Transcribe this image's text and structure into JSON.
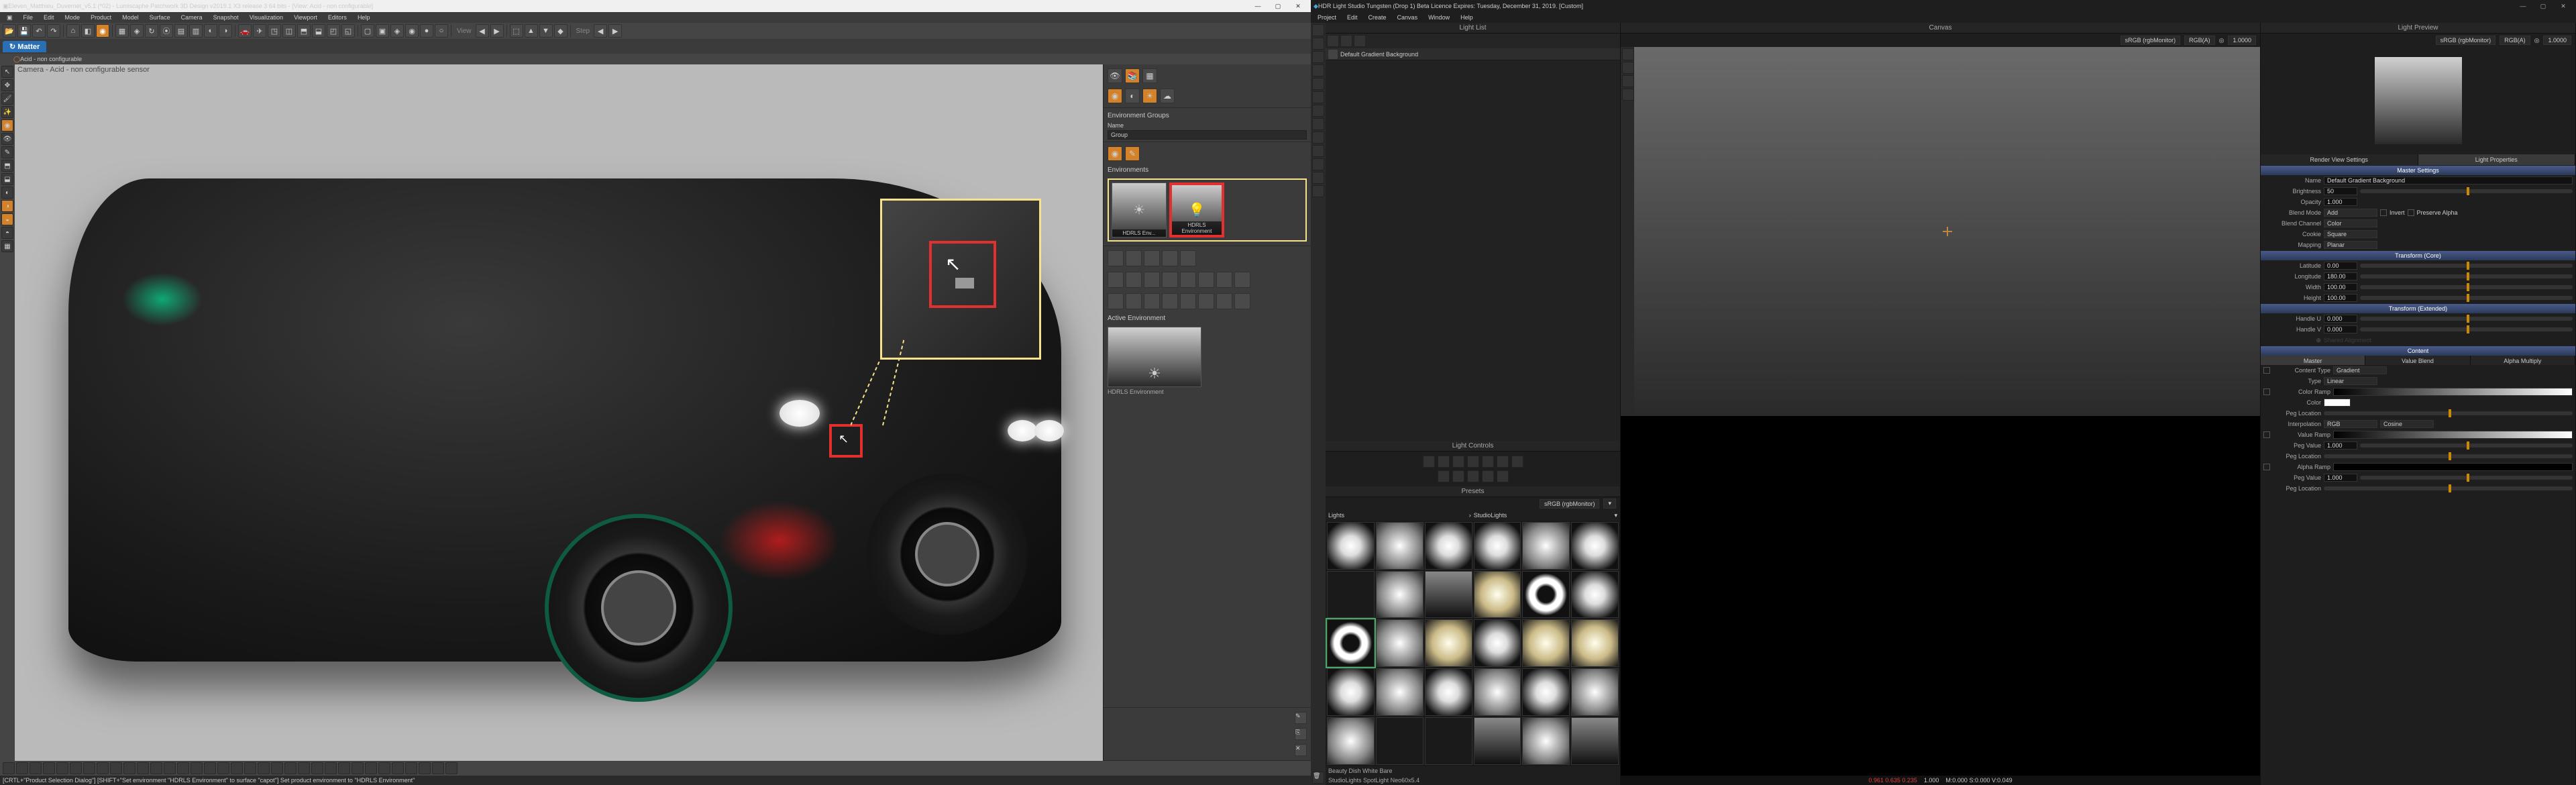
{
  "left": {
    "title": "Eleven_Matthieu_Duvernet_v5.1 (*02) - Lumiscaphe Patchwork 3D Design v2019.1 X3 release 3  64 bits - [View: Acid - non configurable]",
    "menu": [
      "File",
      "Edit",
      "Mode",
      "Product",
      "Model",
      "Surface",
      "Camera",
      "Snapshot",
      "Visualization",
      "Viewport",
      "Editors",
      "Help"
    ],
    "matter_tab": "Matter",
    "sub_label_prefix": "Acid - non configurable",
    "toolbar_view_label": "View",
    "toolbar_step_label": "Step",
    "viewport_label": "Camera - Acid - non configurable sensor",
    "env_panel_title": "Environment Groups",
    "env_name_lbl": "Name",
    "env_name_val": "Group",
    "environments_title": "Environments",
    "env_items": [
      {
        "label": "HDRLS Env..."
      },
      {
        "label": "HDRLS Environment"
      }
    ],
    "active_env_title": "Active Environment",
    "active_env_label": "HDRLS Environment",
    "statusbar": "[CRTL+\"Product Selection Dialog\"] [SHIFT+\"Set environment \"HDRLS Environment\" to surface \"capot\"] Set product environment to \"HDRLS Environment\""
  },
  "right": {
    "title": "HDR Light Studio Tungsten (Drop 1) Beta Licence Expires: Tuesday, December 31, 2019.  [Custom]",
    "menu": [
      "Project",
      "Edit",
      "Create",
      "Canvas",
      "Window",
      "Help"
    ],
    "light_list_title": "Light List",
    "light_row_name": "Default Gradient Background",
    "canvas_title": "Canvas",
    "canvas_colorspace": "sRGB (rgbMonitor)",
    "canvas_channel": "RGB(A)",
    "canvas_exposure": "1.0000",
    "preview_title": "Light Preview",
    "preview_colorspace": "sRGB (rgbMonitor)",
    "preview_channel": "RGB(A)",
    "preview_exposure": "1.0000",
    "light_controls_title": "Light Controls",
    "presets_title": "Presets",
    "presets_colorspace": "sRGB (rgbMonitor)",
    "presets_cat1": "Lights",
    "presets_cat2": "StudioLights",
    "preset_name": "Beauty Dish White Bare",
    "preset_path": "StudioLights SpotLight Neo60x5.4",
    "render_view_title": "Render View Settings",
    "light_props_title": "Light Properties",
    "render_status": {
      "red": "0.961 0.635 0.235",
      "mid": "1.000",
      "coords": "M:0.000 S:0.000 V:0.049"
    },
    "props": {
      "master_hdr": "Master Settings",
      "name_lbl": "Name",
      "name_val": "Default Gradient Background",
      "brightness_lbl": "Brightness",
      "brightness_val": "50",
      "opacity_lbl": "Opacity",
      "opacity_val": "1.000",
      "blendmode_lbl": "Blend Mode",
      "blendmode_val": "Add",
      "invert_lbl": "Invert",
      "preserve_alpha_lbl": "Preserve Alpha",
      "blendch_lbl": "Blend Channel",
      "blendch_val": "Color",
      "cookie_lbl": "Cookie",
      "cookie_val": "Square",
      "mapping_lbl": "Mapping",
      "mapping_val": "Planar",
      "transform_core_hdr": "Transform (Core)",
      "lat_lbl": "Latitude",
      "lat_val": "0.00",
      "lon_lbl": "Longitude",
      "lon_val": "180.00",
      "width_lbl": "Width",
      "width_val": "100.00",
      "height_lbl": "Height",
      "height_val": "100.00",
      "transform_ext_hdr": "Transform (Extended)",
      "hu_lbl": "Handle U",
      "hu_val": "0.000",
      "hv_lbl": "Handle V",
      "hv_val": "0.000",
      "content_hdr": "Content",
      "content_tabs": [
        "Master",
        "Value Blend",
        "Alpha Multiply"
      ],
      "ctype_lbl": "Content Type",
      "ctype_val": "Gradient",
      "type_lbl": "Type",
      "type_val": "Linear",
      "cramp_lbl": "Color Ramp",
      "color_lbl": "Color",
      "pegloc_lbl": "Peg Location",
      "interp_lbl": "Interpolation",
      "interp_val": "RGB",
      "interp_val2": "Cosine",
      "vramp_lbl": "Value Ramp",
      "pegval_lbl": "Peg Value",
      "pegval_val": "1.000",
      "aramp_lbl": "Alpha Ramp"
    }
  }
}
